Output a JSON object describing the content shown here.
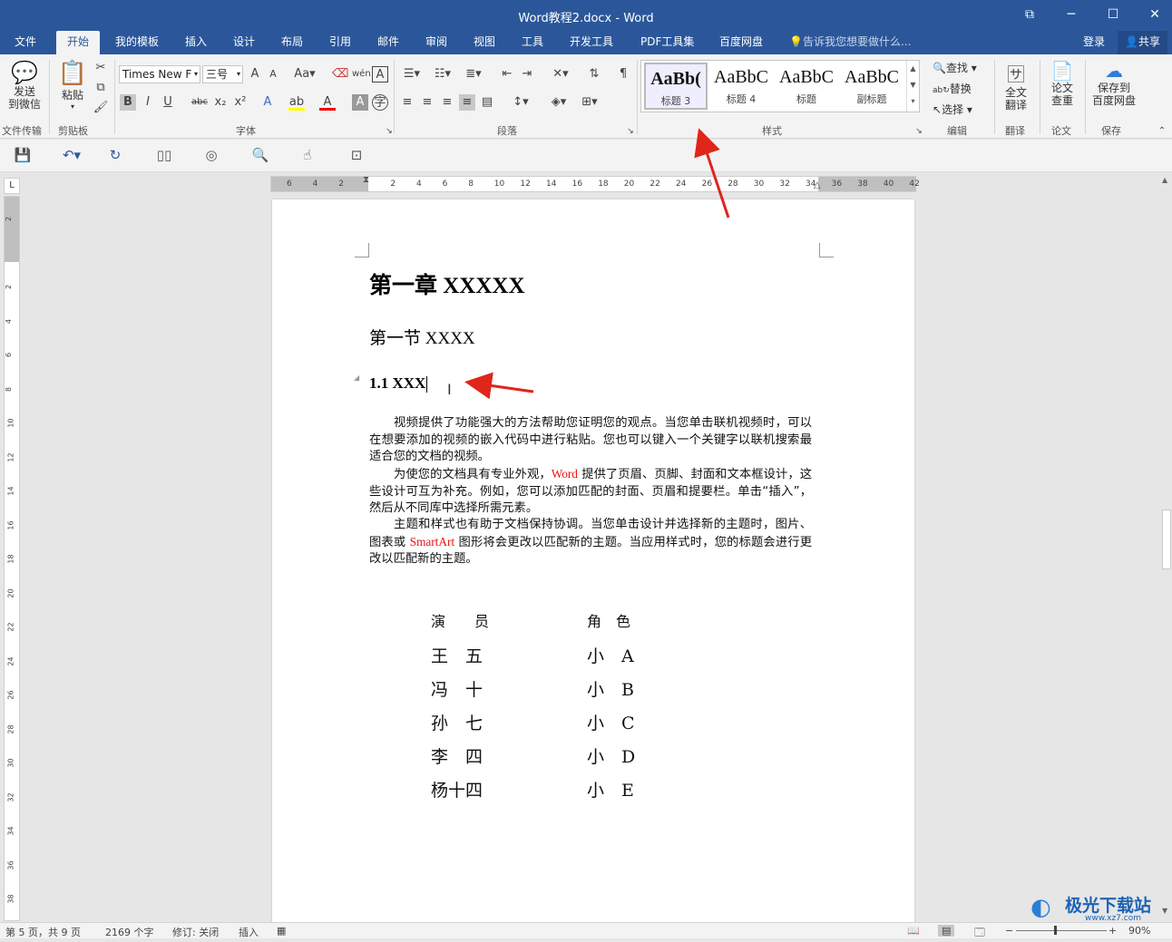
{
  "window": {
    "title": "Word教程2.docx - Word",
    "restore_icon": "ribbon-display-icon",
    "minimize": "─",
    "maximize": "☐",
    "close": "✕"
  },
  "tabs": [
    "文件",
    "开始",
    "我的模板",
    "插入",
    "设计",
    "布局",
    "引用",
    "邮件",
    "审阅",
    "视图",
    "工具",
    "开发工具",
    "PDF工具集",
    "百度网盘"
  ],
  "tell_me": "告诉我您想要做什么...",
  "login": "登录",
  "share": "共享",
  "ribbon": {
    "send_wechat": "发送\n到微信",
    "file_transfer_label": "文件传输",
    "paste": "粘贴",
    "clipboard_label": "剪贴板",
    "font_name": "Times New F",
    "font_size": "三号",
    "font_label": "字体",
    "paragraph_label": "段落",
    "styles": [
      {
        "preview": "AaBb(",
        "name": "标题 3"
      },
      {
        "preview": "AaBbC",
        "name": "标题 4"
      },
      {
        "preview": "AaBbC",
        "name": "标题"
      },
      {
        "preview": "AaBbC",
        "name": "副标题"
      }
    ],
    "styles_label": "样式",
    "find": "查找",
    "replace": "替换",
    "select": "选择",
    "edit_label": "编辑",
    "full_translate": "全文\n翻译",
    "translate_label": "翻译",
    "thesis_check": "论文\n查重",
    "thesis_label": "论文",
    "save_baidu": "保存到\n百度网盘",
    "save_label": "保存"
  },
  "ruler_h": [
    "6",
    "4",
    "2",
    "",
    "2",
    "4",
    "6",
    "8",
    "10",
    "12",
    "14",
    "16",
    "18",
    "20",
    "22",
    "24",
    "26",
    "28",
    "30",
    "32",
    "34",
    "36",
    "38",
    "40",
    "42"
  ],
  "ruler_v": [
    "2",
    "",
    "2",
    "4",
    "6",
    "8",
    "10",
    "12",
    "14",
    "16",
    "18",
    "20",
    "22",
    "24",
    "26",
    "28",
    "30",
    "32",
    "34",
    "36",
    "38"
  ],
  "doc": {
    "chapter": "第一章  XXXXX",
    "section": "第一节  XXXX",
    "subsection": "1.1 XXX",
    "p1": "视频提供了功能强大的方法帮助您证明您的观点。当您单击联机视频时，可以在想要添加的视频的嵌入代码中进行粘贴。您也可以键入一个关键字以联机搜索最适合您的文档的视频。",
    "p2_a": "为使您的文档具有专业外观，",
    "p2_word": "Word",
    "p2_b": " 提供了页眉、页脚、封面和文本框设计，这些设计可互为补充。例如，您可以添加匹配的封面、页眉和提要栏。单击“插入”，然后从不同库中选择所需元素。",
    "p3_a": "主题和样式也有助于文档保持协调。当您单击设计并选择新的主题时，图片、图表或 ",
    "p3_smartart": "SmartArt",
    "p3_b": " 图形将会更改以匹配新的主题。当应用样式时，您的标题会进行更改以匹配新的主题。",
    "table_header": [
      "演　　员",
      "角　色"
    ],
    "table_rows": [
      [
        "王　五",
        "小　A"
      ],
      [
        "冯　十",
        "小　B"
      ],
      [
        "孙　七",
        "小　C"
      ],
      [
        "李　四",
        "小　D"
      ],
      [
        "杨十四",
        "小　E"
      ]
    ]
  },
  "status": {
    "page": "第 5 页，共 9 页",
    "words": "2169 个字",
    "track": "修订: 关闭",
    "mode": "插入",
    "zoom": "90%"
  },
  "watermark": "极光下载站",
  "watermark_url": "www.xz7.com",
  "colors": {
    "brand": "#2b579a",
    "annotation": "#e0251b",
    "highlight_text": "#e11111"
  }
}
